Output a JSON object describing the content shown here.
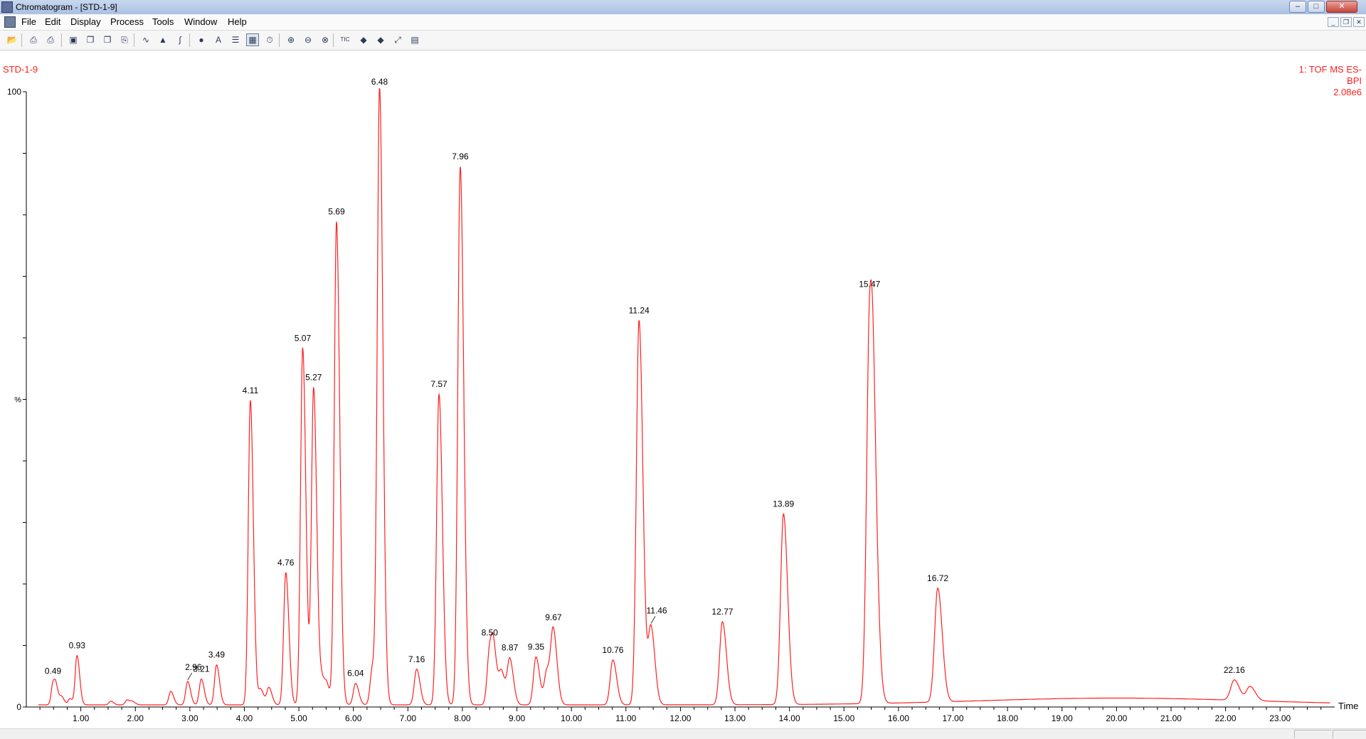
{
  "window": {
    "title": "Chromatogram - [STD-1-9]"
  },
  "menu": {
    "items": [
      "File",
      "Edit",
      "Display",
      "Process",
      "Tools",
      "Window",
      "Help"
    ]
  },
  "window_controls": {
    "minimize": "–",
    "maximize": "□",
    "close": "✕",
    "mdi_minimize": "_",
    "mdi_restore": "❐",
    "mdi_close": "✕"
  },
  "toolbar": {
    "tic_label": "TIC",
    "icons": [
      "open-folder-icon",
      "print-icon",
      "print-preview-icon",
      "camera-icon",
      "copy-icon",
      "copy-list-icon",
      "paste-icon",
      "spectrum-icon",
      "peak-icon",
      "integrate-icon",
      "globe-icon",
      "text-A-icon",
      "window-list-icon",
      "grid-icon",
      "timer-icon",
      "zoom-in-icon",
      "zoom-out-icon",
      "zoom-reset-icon",
      "tic-icon",
      "arrow-left-icon",
      "arrow-right-icon",
      "fit-icon",
      "chart-icon"
    ],
    "glyphs": [
      "📂",
      "⎙",
      "⎙",
      "▣",
      "❐",
      "❐",
      "⎘",
      "∿",
      "▲",
      "∫",
      "●",
      "A",
      "☰",
      "▦",
      "⏱",
      "⊕",
      "⊖",
      "⊗",
      "",
      "◆",
      "◆",
      "⤢",
      "▤"
    ],
    "active_index": 13
  },
  "chart_data": {
    "type": "line",
    "trace_name": "STD-1-9",
    "detector_label_line1": "1: TOF MS ES-",
    "detector_label_line2": "BPI",
    "intensity": "2.08e6",
    "xlabel": "Time",
    "ylabel": "%",
    "xlim": [
      0.0,
      23.95
    ],
    "ylim": [
      0,
      100
    ],
    "x_ticks": [
      "1.00",
      "2.00",
      "3.00",
      "4.00",
      "5.00",
      "6.00",
      "7.00",
      "8.00",
      "9.00",
      "10.00",
      "11.00",
      "12.00",
      "13.00",
      "14.00",
      "15.00",
      "16.00",
      "17.00",
      "18.00",
      "19.00",
      "20.00",
      "21.00",
      "22.00",
      "23.00"
    ],
    "y_ticks": [
      "0",
      "%",
      "100"
    ],
    "color": "#ff2020",
    "peaks": [
      {
        "rt": 0.49,
        "height": 3.5,
        "label": "0.49"
      },
      {
        "rt": 0.93,
        "height": 8.0,
        "label": "0.93"
      },
      {
        "rt": 2.96,
        "height": 3.8,
        "label": "2.96"
      },
      {
        "rt": 3.21,
        "height": 4.2,
        "label": "3.21"
      },
      {
        "rt": 3.49,
        "height": 6.5,
        "label": "3.49"
      },
      {
        "rt": 4.11,
        "height": 49.5,
        "label": "4.11"
      },
      {
        "rt": 4.76,
        "height": 21.5,
        "label": "4.76"
      },
      {
        "rt": 5.07,
        "height": 58.0,
        "label": "5.07"
      },
      {
        "rt": 5.27,
        "height": 51.5,
        "label": "5.27"
      },
      {
        "rt": 5.69,
        "height": 78.5,
        "label": "5.69"
      },
      {
        "rt": 6.04,
        "height": 3.5,
        "label": "6.04"
      },
      {
        "rt": 6.48,
        "height": 100.0,
        "label": "6.48"
      },
      {
        "rt": 7.16,
        "height": 5.8,
        "label": "7.16"
      },
      {
        "rt": 7.57,
        "height": 50.5,
        "label": "7.57"
      },
      {
        "rt": 7.96,
        "height": 87.5,
        "label": "7.96"
      },
      {
        "rt": 8.5,
        "height": 8.8,
        "label": "8.50"
      },
      {
        "rt": 8.87,
        "height": 7.3,
        "label": "8.87"
      },
      {
        "rt": 9.35,
        "height": 7.8,
        "label": "9.35"
      },
      {
        "rt": 9.67,
        "height": 11.5,
        "label": "9.67"
      },
      {
        "rt": 10.76,
        "height": 7.3,
        "label": "10.76"
      },
      {
        "rt": 11.24,
        "height": 62.5,
        "label": "11.24"
      },
      {
        "rt": 11.46,
        "height": 12.5,
        "label": "11.46"
      },
      {
        "rt": 12.77,
        "height": 13.5,
        "label": "12.77"
      },
      {
        "rt": 13.89,
        "height": 31.0,
        "label": "13.89"
      },
      {
        "rt": 15.47,
        "height": 59.5,
        "label": "15.47"
      },
      {
        "rt": 16.72,
        "height": 18.5,
        "label": "16.72"
      },
      {
        "rt": 22.16,
        "height": 3.3,
        "label": "22.16"
      }
    ],
    "minor_peaks": [
      {
        "rt": 0.55,
        "height": 2.0
      },
      {
        "rt": 0.65,
        "height": 1.2
      },
      {
        "rt": 0.8,
        "height": 1.0
      },
      {
        "rt": 1.55,
        "height": 0.6
      },
      {
        "rt": 1.85,
        "height": 0.8
      },
      {
        "rt": 1.95,
        "height": 0.5
      },
      {
        "rt": 2.65,
        "height": 2.2
      },
      {
        "rt": 4.3,
        "height": 2.5
      },
      {
        "rt": 4.45,
        "height": 2.8
      },
      {
        "rt": 5.43,
        "height": 3.8
      },
      {
        "rt": 5.52,
        "height": 2.5
      },
      {
        "rt": 6.35,
        "height": 6.0
      },
      {
        "rt": 8.58,
        "height": 6.5
      },
      {
        "rt": 8.72,
        "height": 5.0
      },
      {
        "rt": 9.55,
        "height": 5.5
      },
      {
        "rt": 15.55,
        "height": 20.0
      },
      {
        "rt": 22.45,
        "height": 2.3
      }
    ],
    "baseline_hump": {
      "center": 20.0,
      "width": 2.5,
      "height": 1.1
    }
  }
}
